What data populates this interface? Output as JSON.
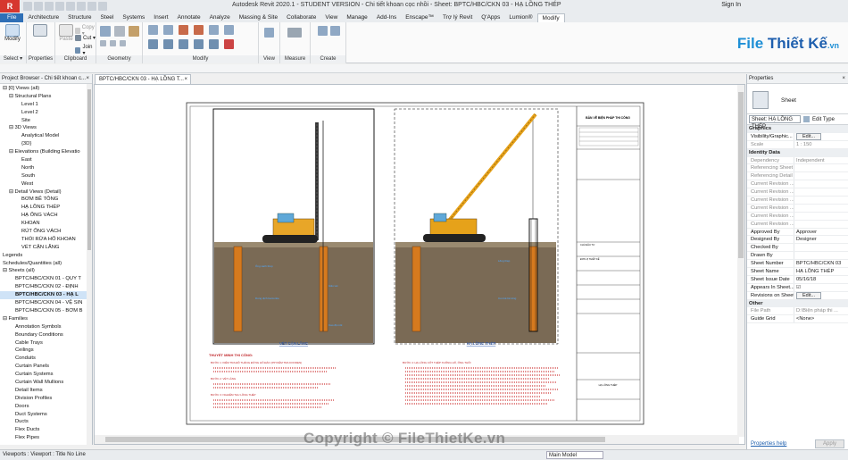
{
  "app": {
    "title": "Autodesk Revit 2020.1 - STUDENT VERSION - Chi tiết khoan cọc nhồi - Sheet: BPTC/HBC/CKN 03 - HẠ LỒNG THÉP",
    "sign_in": "Sign In",
    "logo_text": "R"
  },
  "tabs": [
    "File",
    "Architecture",
    "Structure",
    "Steel",
    "Systems",
    "Insert",
    "Annotate",
    "Analyze",
    "Massing & Site",
    "Collaborate",
    "View",
    "Manage",
    "Add-Ins",
    "Enscape™",
    "Trợ lý Revit",
    "Q'Apps",
    "Lumion®",
    "Modify"
  ],
  "active_tab": "Modify",
  "ribbon": {
    "modify_label": "Modify",
    "select_label": "Select ▾",
    "properties_label": "Properties",
    "clipboard_label": "Clipboard",
    "paste_label": "Paste",
    "copy_label": "Copy ▾",
    "cut_label": "Cut ▾",
    "join_label": "Join ▾",
    "geometry_label": "Geometry",
    "modify_group_label": "Modify",
    "view_label": "View",
    "measure_label": "Measure",
    "create_label": "Create"
  },
  "brand": {
    "file": "File",
    "thiet_ke": "Thiết Kế",
    "vn": ".vn"
  },
  "project_browser": {
    "title": "Project Browser - Chi tiết khoan c...",
    "close": "×",
    "items": [
      {
        "label": "⊟ [0] Views (all)",
        "indent": 0,
        "bold": false
      },
      {
        "label": "⊟ Structural Plans",
        "indent": 1,
        "bold": false
      },
      {
        "label": "Level 1",
        "indent": 3,
        "bold": false
      },
      {
        "label": "Level 2",
        "indent": 3,
        "bold": false
      },
      {
        "label": "Site",
        "indent": 3,
        "bold": false
      },
      {
        "label": "⊟ 3D Views",
        "indent": 1,
        "bold": false
      },
      {
        "label": "Analytical Model",
        "indent": 3,
        "bold": false
      },
      {
        "label": "{3D}",
        "indent": 3,
        "bold": false
      },
      {
        "label": "⊟ Elevations (Building Elevatio",
        "indent": 1,
        "bold": false
      },
      {
        "label": "East",
        "indent": 3,
        "bold": false
      },
      {
        "label": "North",
        "indent": 3,
        "bold": false
      },
      {
        "label": "South",
        "indent": 3,
        "bold": false
      },
      {
        "label": "West",
        "indent": 3,
        "bold": false
      },
      {
        "label": "⊟ Detail Views (Detail)",
        "indent": 1,
        "bold": false
      },
      {
        "label": "BƠM BÊ TÔNG",
        "indent": 3,
        "bold": false
      },
      {
        "label": "HẠ LỒNG THÉP",
        "indent": 3,
        "bold": false
      },
      {
        "label": "HẠ ỐNG VÁCH",
        "indent": 3,
        "bold": false
      },
      {
        "label": "KHOAN",
        "indent": 3,
        "bold": false
      },
      {
        "label": "RÚT ỐNG VÁCH",
        "indent": 3,
        "bold": false
      },
      {
        "label": "THỔI RỬA HỐ KHOAN",
        "indent": 3,
        "bold": false
      },
      {
        "label": "VÉT CẶN LẮNG",
        "indent": 3,
        "bold": false
      },
      {
        "label": "Legends",
        "indent": 0,
        "bold": false
      },
      {
        "label": "Schedules/Quantities (all)",
        "indent": 0,
        "bold": false
      },
      {
        "label": "⊟ Sheets (all)",
        "indent": 0,
        "bold": false
      },
      {
        "label": "BPTC/HBC/CKN 01 - QUY T",
        "indent": 2,
        "bold": false
      },
      {
        "label": "BPTC/HBC/CKN 02 - ĐỊNH",
        "indent": 2,
        "bold": false
      },
      {
        "label": "BPTC/HBC/CKN 03 - HẠ L",
        "indent": 2,
        "bold": true
      },
      {
        "label": "BPTC/HBC/CKN 04 - VỆ SIN",
        "indent": 2,
        "bold": false
      },
      {
        "label": "BPTC/HBC/CKN 05 - BƠM B",
        "indent": 2,
        "bold": false
      },
      {
        "label": "⊟ Families",
        "indent": 0,
        "bold": false
      },
      {
        "label": "Annotation Symbols",
        "indent": 2,
        "bold": false
      },
      {
        "label": "Boundary Conditions",
        "indent": 2,
        "bold": false
      },
      {
        "label": "Cable Trays",
        "indent": 2,
        "bold": false
      },
      {
        "label": "Ceilings",
        "indent": 2,
        "bold": false
      },
      {
        "label": "Conduits",
        "indent": 2,
        "bold": false
      },
      {
        "label": "Curtain Panels",
        "indent": 2,
        "bold": false
      },
      {
        "label": "Curtain Systems",
        "indent": 2,
        "bold": false
      },
      {
        "label": "Curtain Wall Mullions",
        "indent": 2,
        "bold": false
      },
      {
        "label": "Detail Items",
        "indent": 2,
        "bold": false
      },
      {
        "label": "Division Profiles",
        "indent": 2,
        "bold": false
      },
      {
        "label": "Doors",
        "indent": 2,
        "bold": false
      },
      {
        "label": "Duct Systems",
        "indent": 2,
        "bold": false
      },
      {
        "label": "Ducts",
        "indent": 2,
        "bold": false
      },
      {
        "label": "Flex Ducts",
        "indent": 2,
        "bold": false
      },
      {
        "label": "Flex Pipes",
        "indent": 2,
        "bold": false
      }
    ]
  },
  "view_tab": {
    "label": "BPTC/HBC/CKN 03 - HẠ LỒNG T...",
    "close": "×"
  },
  "sheet": {
    "caption_left": "VÉT CẶN LẮNG",
    "caption_right": "HẠ LỒNG THÉP",
    "title_block_header": "BẢN VẼ BIỆN PHÁP THI CÔNG",
    "notes_title": "THUYẾT MINH THI CÔNG:",
    "step1": "BƯỚC 1: KIỂM TRA ĐỘ THẲNG ĐỨNG HỐ ĐÀO (PP KIỂM TRA KOODEN)",
    "step2": "BƯỚC 2: VÉT LẮNG",
    "step3": "BƯỚC 3: NGHIỆM THU LỒNG THÉP",
    "step4": "BƯỚC 4: HẠ LỒNG CỐT THÉP XUỐNG HỐ, ỐNG THỐI",
    "tb_label_1": "CHỦ ĐẦU TƯ",
    "tb_label_2": "ĐƠN VỊ THIẾT KẾ",
    "tb_label_3": "HẠ LỒNG THÉP"
  },
  "properties": {
    "title": "Properties",
    "close": "×",
    "type_name": "Sheet",
    "selector": "Sheet: HẠ LỒNG THÉP",
    "edit_type": "Edit Type",
    "groups": [
      {
        "name": "Graphics",
        "rows": [
          {
            "k": "Visibility/Graphic...",
            "v": "Edit...",
            "btn": true,
            "dim": false
          },
          {
            "k": "Scale",
            "v": "1 : 150",
            "btn": false,
            "dim": true
          }
        ]
      },
      {
        "name": "Identity Data",
        "rows": [
          {
            "k": "Dependency",
            "v": "Independent",
            "btn": false,
            "dim": true
          },
          {
            "k": "Referencing Sheet",
            "v": "",
            "btn": false,
            "dim": true
          },
          {
            "k": "Referencing Detail",
            "v": "",
            "btn": false,
            "dim": true
          },
          {
            "k": "Current Revision ...",
            "v": "",
            "btn": false,
            "dim": true
          },
          {
            "k": "Current Revision ...",
            "v": "",
            "btn": false,
            "dim": true
          },
          {
            "k": "Current Revision ...",
            "v": "",
            "btn": false,
            "dim": true
          },
          {
            "k": "Current Revision ...",
            "v": "",
            "btn": false,
            "dim": true
          },
          {
            "k": "Current Revision ...",
            "v": "",
            "btn": false,
            "dim": true
          },
          {
            "k": "Current Revision ...",
            "v": "",
            "btn": false,
            "dim": true
          },
          {
            "k": "Approved By",
            "v": "Approver",
            "btn": false,
            "dim": false
          },
          {
            "k": "Designed By",
            "v": "Designer",
            "btn": false,
            "dim": false
          },
          {
            "k": "Checked By",
            "v": "",
            "btn": false,
            "dim": false
          },
          {
            "k": "Drawn By",
            "v": "",
            "btn": false,
            "dim": false
          },
          {
            "k": "Sheet Number",
            "v": "BPTC/HBC/CKN 03",
            "btn": false,
            "dim": false
          },
          {
            "k": "Sheet Name",
            "v": "HẠ LỒNG THÉP",
            "btn": false,
            "dim": false
          },
          {
            "k": "Sheet Issue Date",
            "v": "05/16/18",
            "btn": false,
            "dim": false
          },
          {
            "k": "Appears In Sheet...",
            "v": "☑",
            "btn": false,
            "dim": false
          },
          {
            "k": "Revisions on Sheet",
            "v": "Edit...",
            "btn": true,
            "dim": false
          }
        ]
      },
      {
        "name": "Other",
        "rows": [
          {
            "k": "File Path",
            "v": "D:\\Biện pháp thi ...",
            "btn": false,
            "dim": true
          },
          {
            "k": "Guide Grid",
            "v": "<None>",
            "btn": false,
            "dim": false
          }
        ]
      }
    ],
    "help": "Properties help",
    "apply": "Apply"
  },
  "status": {
    "text": "Viewports : Viewport : Title No Line",
    "main_model": "Main Model"
  },
  "watermark": "Copyright © FileThietKe.vn",
  "colors": {
    "soil": "#7a6a55",
    "casing": "#d67a1e",
    "crane": "#e6a21a",
    "accent_blue": "#2f6fb6"
  }
}
